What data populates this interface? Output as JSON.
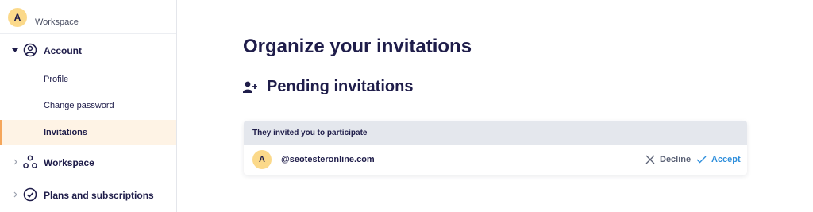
{
  "workspace": {
    "avatar_letter": "A",
    "name": "Workspace"
  },
  "sidebar": {
    "account": {
      "label": "Account",
      "expanded": true
    },
    "account_items": [
      {
        "label": "Profile",
        "active": false
      },
      {
        "label": "Change password",
        "active": false
      },
      {
        "label": "Invitations",
        "active": true
      }
    ],
    "workspace": {
      "label": "Workspace",
      "expanded": false
    },
    "plans": {
      "label": "Plans and subscriptions",
      "expanded": false
    }
  },
  "main": {
    "title": "Organize your invitations",
    "section_title": "Pending invitations",
    "table": {
      "column_header": "They invited you to participate",
      "rows": [
        {
          "avatar_letter": "A",
          "email": "@seotesteronline.com",
          "decline_label": "Decline",
          "accept_label": "Accept"
        }
      ]
    }
  },
  "colors": {
    "text_dark": "#1f1d4a",
    "avatar_bg": "#fbd98a",
    "active_bg": "#fef3e5",
    "active_border": "#f5a65b",
    "accept": "#2f8fdc",
    "decline": "#5b6276",
    "table_header_bg": "#e4e7ed"
  }
}
